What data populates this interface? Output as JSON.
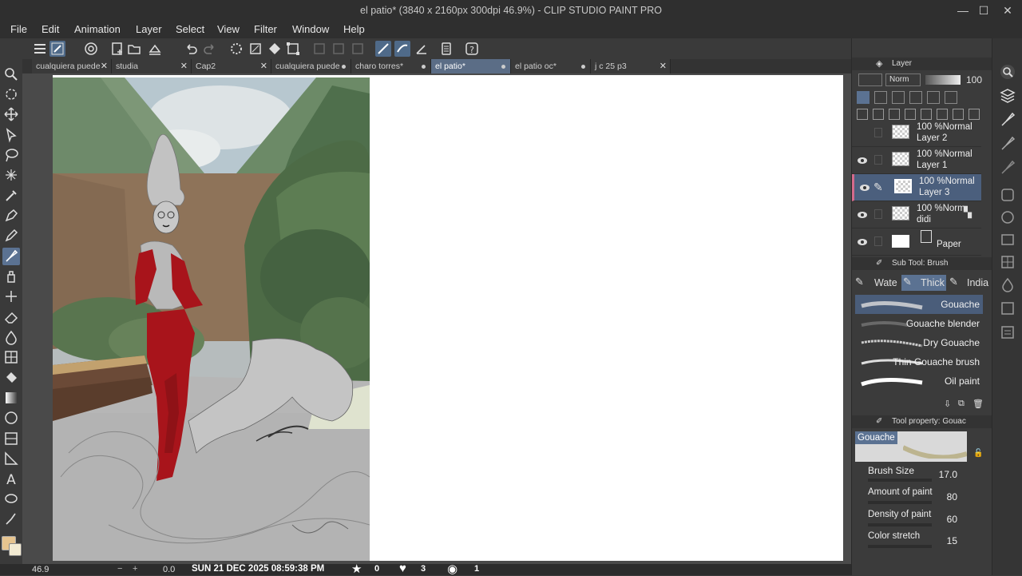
{
  "window": {
    "title": "el patio* (3840 x 2160px 300dpi 46.9%) - CLIP STUDIO PAINT PRO",
    "minimize": "—",
    "maximize": "☐",
    "close": "✕"
  },
  "menu": [
    "File",
    "Edit",
    "Animation",
    "Layer",
    "Select",
    "View",
    "Filter",
    "Window",
    "Help"
  ],
  "tabs": [
    {
      "label": "cualquiera puede",
      "state": "close"
    },
    {
      "label": "studia",
      "state": "close"
    },
    {
      "label": "Cap2",
      "state": "close"
    },
    {
      "label": "cualquiera puede",
      "state": "modified"
    },
    {
      "label": "charo torres*",
      "state": "modified"
    },
    {
      "label": "el patio*",
      "state": "modified",
      "active": true
    },
    {
      "label": "el patio oc*",
      "state": "modified"
    },
    {
      "label": "j c 25 p3",
      "state": "close"
    }
  ],
  "layer_panel": {
    "title": "Layer",
    "blend_mode": "Norm",
    "opacity": "100",
    "layers": [
      {
        "mode": "100 %Normal",
        "name": "Layer 2",
        "visible": false
      },
      {
        "mode": "100 %Normal",
        "name": "Layer 1",
        "visible": true
      },
      {
        "mode": "100 %Normal",
        "name": "Layer 3",
        "visible": true,
        "selected": true
      },
      {
        "mode": "100 %Norm",
        "name": "didi",
        "visible": true
      },
      {
        "mode": "",
        "name": "Paper",
        "visible": true
      }
    ]
  },
  "sub_tool_panel": {
    "title": "Sub Tool: Brush",
    "groups": [
      "Wate",
      "Thick",
      "India"
    ],
    "brushes": [
      "Gouache",
      "Gouache blender",
      "Dry Gouache",
      "Thin Gouache brush",
      "Oil paint"
    ]
  },
  "tool_property": {
    "title": "Tool property: Gouac",
    "preset_name": "Gouache",
    "properties": [
      {
        "label": "Brush Size",
        "value": "17.0"
      },
      {
        "label": "Amount of paint",
        "value": "80"
      },
      {
        "label": "Density of paint",
        "value": "60"
      },
      {
        "label": "Color stretch",
        "value": "15"
      }
    ]
  },
  "status": {
    "zoom": "46.9",
    "rotation": "0.0",
    "datetime": "SUN 21 DEC 2025 08:59:38 PM",
    "stars": "0",
    "hearts": "3",
    "views": "1"
  },
  "colors": {
    "main_color": "#e6c48f",
    "sub_color": "#f2ead2",
    "accent": "#5b7292"
  }
}
